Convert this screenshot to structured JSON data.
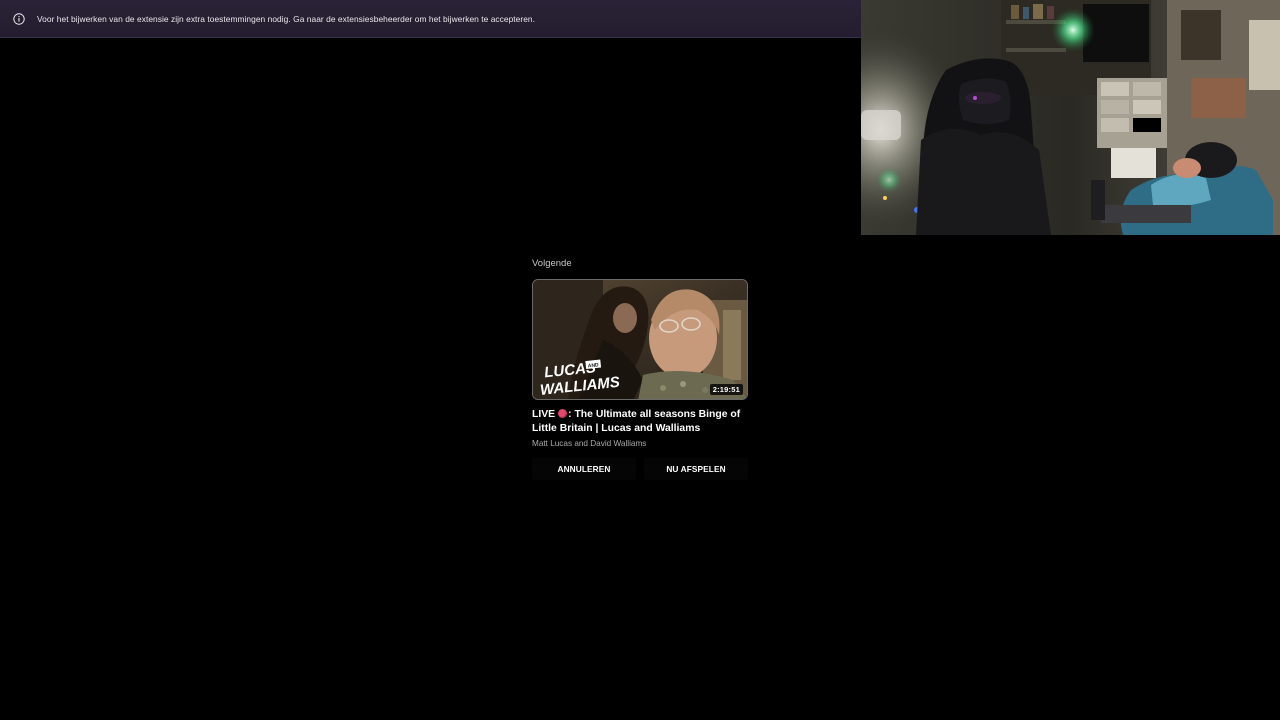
{
  "notification": {
    "icon": "info-icon",
    "text": "Voor het bijwerken van de extensie zijn extra toestemmingen nodig. Ga naar de extensiesbeheerder om het bijwerken te accepteren."
  },
  "webcam": {
    "icon": "webcam-feed"
  },
  "up_next": {
    "label": "Volgende",
    "thumbnail": {
      "logo_line1": "LUCAS",
      "logo_and": "AND",
      "logo_line2": "WALLIAMS",
      "duration": "2:19:51"
    },
    "title_prefix": "LIVE",
    "title_suffix": ": The Ultimate all seasons Binge of Little Britain | Lucas and Walliams",
    "channel": "Matt Lucas and David Walliams",
    "cancel_label": "ANNULEREN",
    "play_label": "NU AFSPELEN"
  },
  "colors": {
    "notification_bg": "#2a2236",
    "live_dot": "#e2486c",
    "background": "#000000"
  }
}
